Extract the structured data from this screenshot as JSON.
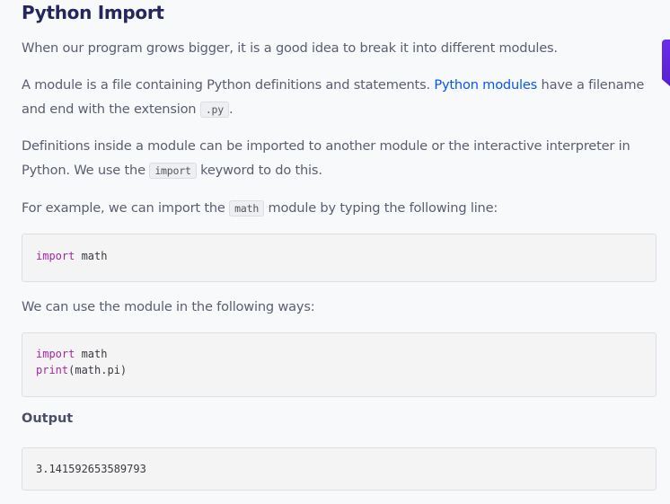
{
  "title": "Python Import",
  "p1": "When our program grows bigger, it is a good idea to break it into different modules.",
  "p2": {
    "a": "A module is a file containing Python definitions and statements. ",
    "link": "Python modules",
    "b": " have a filename and end with the extension ",
    "code": ".py",
    "c": "."
  },
  "p3": {
    "a": "Definitions inside a module can be imported to another module or the interactive interpreter in Python. We use the ",
    "code": "import",
    "b": " keyword to do this."
  },
  "p4": {
    "a": "For example, we can import the ",
    "code": "math",
    "b": " module by typing the following line:"
  },
  "code1": {
    "kw": "import",
    "rest": " math"
  },
  "p5": "We can use the module in the following ways:",
  "code2": {
    "l1kw": "import",
    "l1rest": " math",
    "l2fn": "print",
    "l2rest": "(math.pi)"
  },
  "output_heading": "Output",
  "output": "3.141592653589793",
  "colors": {
    "accent_link": "#0556f3",
    "keyword": "#a626a4",
    "tab": "#6a2ee8"
  }
}
